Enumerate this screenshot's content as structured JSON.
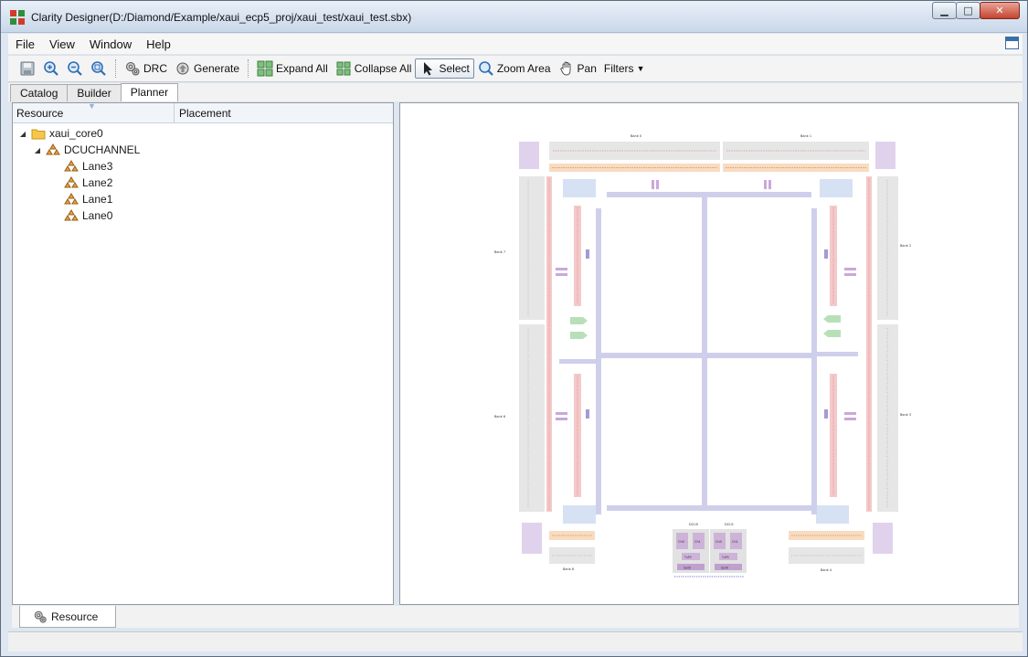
{
  "window": {
    "title": "Clarity Designer(D:/Diamond/Example/xaui_ecp5_proj/xaui_test/xaui_test.sbx)"
  },
  "menu": {
    "items": [
      "File",
      "View",
      "Window",
      "Help"
    ]
  },
  "toolbar": {
    "drc": "DRC",
    "generate": "Generate",
    "expand_all": "Expand All",
    "collapse_all": "Collapse All",
    "select": "Select",
    "zoom_area": "Zoom Area",
    "pan": "Pan",
    "filters": "Filters"
  },
  "tabs": [
    "Catalog",
    "Builder",
    "Planner"
  ],
  "active_tab": "Planner",
  "resource_panel": {
    "columns": [
      "Resource",
      "Placement"
    ],
    "tree": [
      {
        "label": "xaui_core0",
        "level": 0,
        "icon": "folder-icon"
      },
      {
        "label": "DCUCHANNEL",
        "level": 1,
        "icon": "module-icon"
      },
      {
        "label": "Lane3",
        "level": 2,
        "icon": "lane-icon"
      },
      {
        "label": "Lane2",
        "level": 2,
        "icon": "lane-icon"
      },
      {
        "label": "Lane1",
        "level": 2,
        "icon": "lane-icon"
      },
      {
        "label": "Lane0",
        "level": 2,
        "icon": "lane-icon"
      }
    ]
  },
  "floorplan": {
    "bank_labels": {
      "top_left": "Bank 0",
      "top_right": "Bank 1",
      "left_top": "Bank 7",
      "left_bottom": "Bank 6",
      "right_top": "Bank 2",
      "right_bottom": "Bank 3",
      "bottom_left": "Bank 8",
      "bottom_right": "Bank 4"
    },
    "dcu_labels": [
      "DCU0",
      "DCU1"
    ],
    "dcu_cells": [
      "Ch0",
      "Ch1",
      "Ch0",
      "Ch1"
    ],
    "dcu_sub": [
      "TxPll",
      "TxPll"
    ],
    "dcu_bottom": [
      "Serdl",
      "Serdl"
    ]
  },
  "bottom_tab": {
    "label": "Resource"
  },
  "colors": {
    "purple": "#d9c8e6",
    "lavender": "#c9c6ea",
    "pale_blue": "#d6e0f2",
    "gray": "#e6e6e6",
    "pink": "#f3c4c4",
    "orange": "#f7d8b8",
    "green": "#bfe3bf"
  }
}
